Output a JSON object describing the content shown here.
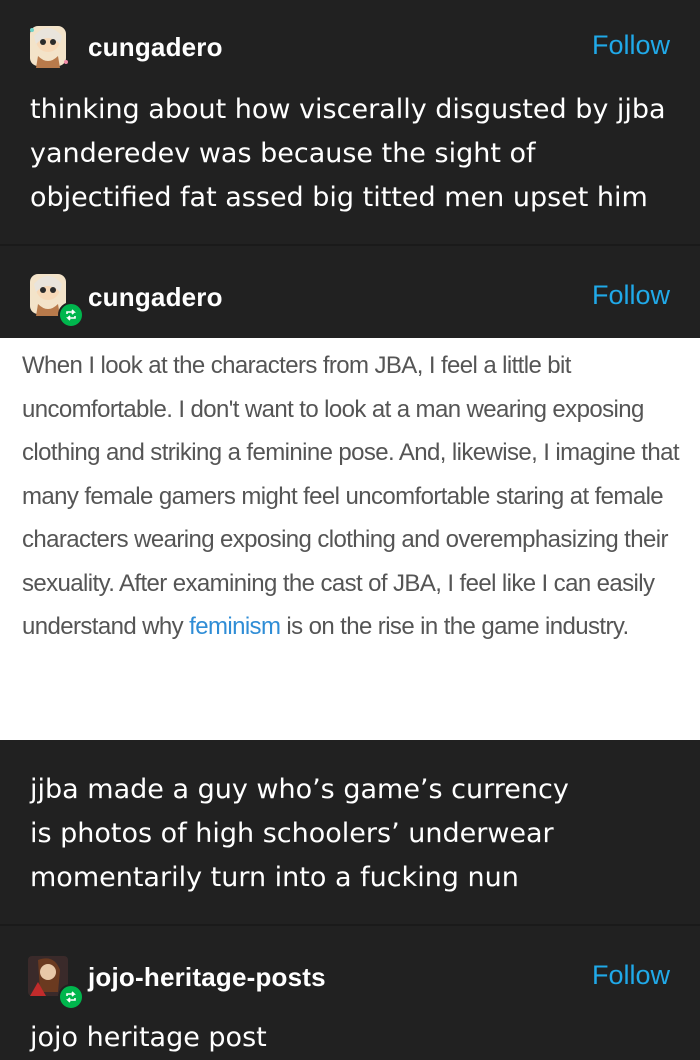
{
  "posts": [
    {
      "username": "cungadero",
      "follow_label": "Follow",
      "text": "thinking about how viscerally disgusted by jjba yanderedev was because the sight of objectified fat assed big titted men upset him"
    },
    {
      "username": "cungadero",
      "follow_label": "Follow",
      "quote_before": "When I look at the characters from JBA, I feel a little bit uncomfortable. I don't want to look at a man wearing exposing clothing and striking a feminine pose. And, likewise, I imagine that many female gamers might feel uncomfortable staring at female characters wearing exposing clothing and overemphasizing their sexuality. After examining the cast of JBA, I feel like I can easily understand why ",
      "quote_link": "feminism",
      "quote_after": " is on the rise in the game industry.",
      "text": "jjba made a guy who’s game’s currency is photos of high schoolers’ underwear momentarily turn into a fucking nun"
    },
    {
      "username": "jojo-heritage-posts",
      "follow_label": "Follow",
      "text": "jojo heritage post"
    }
  ],
  "colors": {
    "background": "#212121",
    "follow": "#20a9e8",
    "reblog_badge": "#00b64d",
    "quote_background": "#ffffff",
    "quote_text": "#555555",
    "link": "#2f8dd6"
  }
}
